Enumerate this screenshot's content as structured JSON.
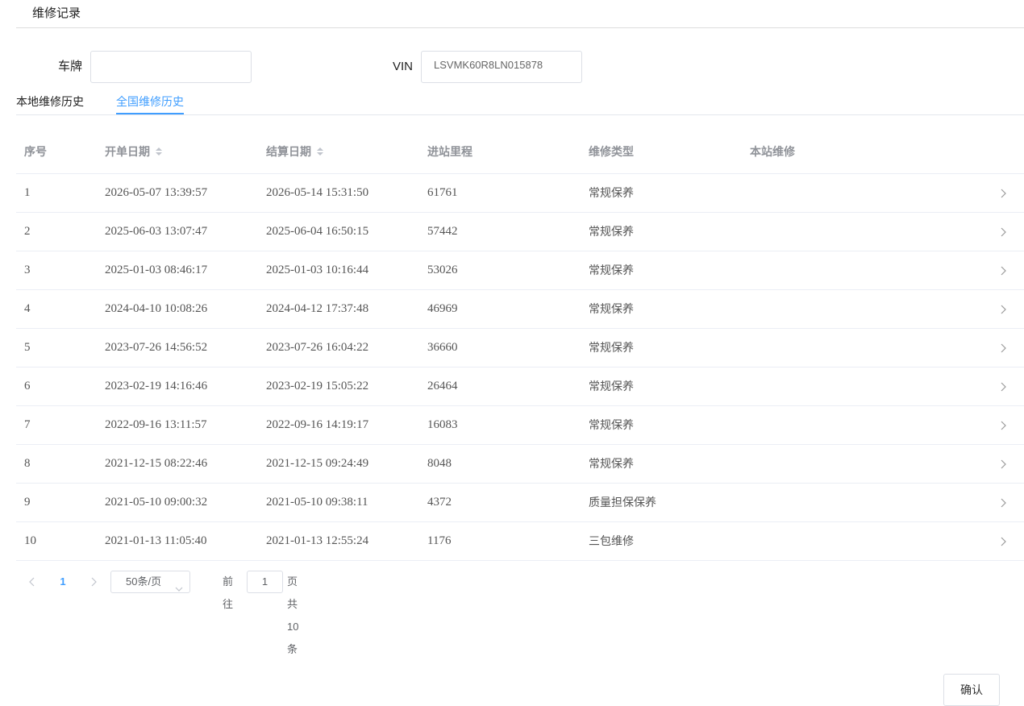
{
  "page": {
    "title": "维修记录"
  },
  "search": {
    "plate_label": "车牌",
    "plate_value": "",
    "vin_label": "VIN",
    "vin_value": "LSVMK60R8LN015878"
  },
  "tabs": [
    {
      "label": "本地维修历史",
      "active": false
    },
    {
      "label": "全国维修历史",
      "active": true
    }
  ],
  "table": {
    "columns": [
      "序号",
      "开单日期",
      "结算日期",
      "进站里程",
      "维修类型",
      "本站维修"
    ],
    "sortable_columns": [
      "开单日期",
      "结算日期"
    ],
    "rows": [
      {
        "index": "1",
        "open_date": "2026-05-07 13:39:57",
        "close_date": "2026-05-14 15:31:50",
        "mileage": "61761",
        "type": "常规保养",
        "local": ""
      },
      {
        "index": "2",
        "open_date": "2025-06-03 13:07:47",
        "close_date": "2025-06-04 16:50:15",
        "mileage": "57442",
        "type": "常规保养",
        "local": ""
      },
      {
        "index": "3",
        "open_date": "2025-01-03 08:46:17",
        "close_date": "2025-01-03 10:16:44",
        "mileage": "53026",
        "type": "常规保养",
        "local": ""
      },
      {
        "index": "4",
        "open_date": "2024-04-10 10:08:26",
        "close_date": "2024-04-12 17:37:48",
        "mileage": "46969",
        "type": "常规保养",
        "local": ""
      },
      {
        "index": "5",
        "open_date": "2023-07-26 14:56:52",
        "close_date": "2023-07-26 16:04:22",
        "mileage": "36660",
        "type": "常规保养",
        "local": ""
      },
      {
        "index": "6",
        "open_date": "2023-02-19 14:16:46",
        "close_date": "2023-02-19 15:05:22",
        "mileage": "26464",
        "type": "常规保养",
        "local": ""
      },
      {
        "index": "7",
        "open_date": "2022-09-16 13:11:57",
        "close_date": "2022-09-16 14:19:17",
        "mileage": "16083",
        "type": "常规保养",
        "local": ""
      },
      {
        "index": "8",
        "open_date": "2021-12-15 08:22:46",
        "close_date": "2021-12-15 09:24:49",
        "mileage": "8048",
        "type": "常规保养",
        "local": ""
      },
      {
        "index": "9",
        "open_date": "2021-05-10 09:00:32",
        "close_date": "2021-05-10 09:38:11",
        "mileage": "4372",
        "type": "质量担保保养",
        "local": ""
      },
      {
        "index": "10",
        "open_date": "2021-01-13 11:05:40",
        "close_date": "2021-01-13 12:55:24",
        "mileage": "1176",
        "type": "三包维修",
        "local": ""
      }
    ]
  },
  "pagination": {
    "current_page": "1",
    "page_size": "50条/页",
    "goto_label": "前往",
    "goto_value": "1",
    "total_text": "页共 10 条"
  },
  "footer": {
    "confirm_label": "确认"
  },
  "colors": {
    "accent": "#409eff",
    "border": "#dcdfe6",
    "header_text": "#909399"
  },
  "icons": [
    "chevron-right-icon",
    "chevron-left-icon",
    "chevron-down-icon",
    "sort-caret-icon"
  ]
}
